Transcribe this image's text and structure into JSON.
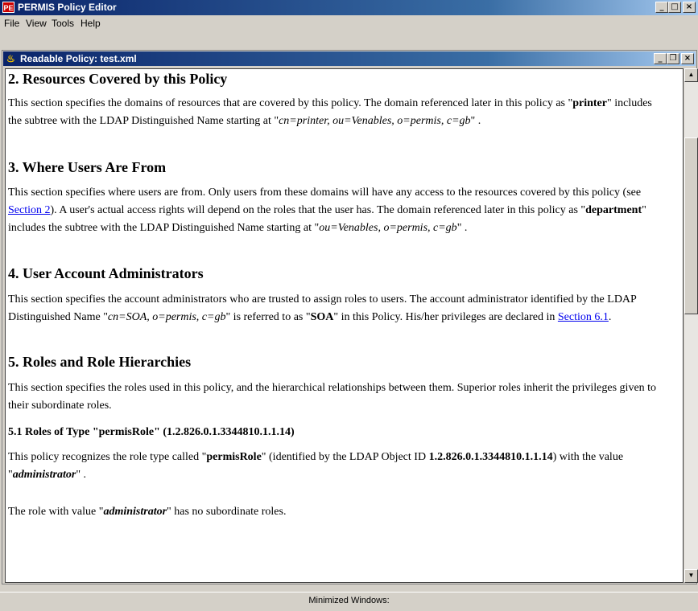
{
  "app": {
    "icon_text": "PE",
    "title": "PERMIS Policy Editor"
  },
  "menu": {
    "file": "File",
    "view": "View",
    "tools": "Tools",
    "help": "Help"
  },
  "inner_window": {
    "title": "Readable Policy: test.xml"
  },
  "document": {
    "s2_heading": "2. Resources Covered by this Policy",
    "s2_text1": "This section specifies the domains of resources that are covered by this policy. The domain referenced later in this policy as \"",
    "s2_bold": "printer",
    "s2_text2": "\" includes the subtree with the LDAP Distinguished Name starting at \"",
    "s2_italic": "cn=printer, ou=Venables, o=permis, c=gb",
    "s2_text3": "\" .",
    "s3_heading": "3. Where Users Are From",
    "s3_text1": "This section specifies where users are from. Only users from these domains will have any access to the resources covered by this policy (see ",
    "s3_link": "Section 2",
    "s3_text2": "). A user's actual access rights will depend on the roles that the user has. The domain referenced later in this policy as \"",
    "s3_bold": "department",
    "s3_text3": "\" includes the subtree with the LDAP Distinguished Name starting at \"",
    "s3_italic": "ou=Venables, o=permis, c=gb",
    "s3_text4": "\" .",
    "s4_heading": "4. User Account Administrators",
    "s4_text1": "This section specifies the account administrators who are trusted to assign roles to users. The account administrator identified by the LDAP Distinguished Name \"",
    "s4_italic": "cn=SOA, o=permis, c=gb",
    "s4_text2": "\" is referred to as \"",
    "s4_bold": "SOA",
    "s4_text3": "\" in this Policy. His/her privileges are declared in ",
    "s4_link": "Section 6.1",
    "s4_text4": ".",
    "s5_heading": "5. Roles and Role Hierarchies",
    "s5_text": "This section specifies the roles used in this policy, and the hierarchical relationships between them. Superior roles inherit the privileges given to their subordinate roles.",
    "s51_heading": "5.1 Roles of Type \"permisRole\" (1.2.826.0.1.3344810.1.1.14)",
    "s51_text1": "This policy recognizes the role type called \"",
    "s51_bold1": "permisRole",
    "s51_text2": "\" (identified by the LDAP Object ID ",
    "s51_bold2": "1.2.826.0.1.3344810.1.1.14",
    "s51_text3": ") with the value \"",
    "s51_bi": "administrator",
    "s51_text4": "\" .",
    "s51_p2_text1": "The role with value \"",
    "s51_p2_bi": "administrator",
    "s51_p2_text2": "\" has no subordinate roles."
  },
  "status": {
    "minimized": "Minimized Windows:"
  },
  "colors": {
    "title_bar": "#0a246a",
    "link": "#0000ee"
  }
}
